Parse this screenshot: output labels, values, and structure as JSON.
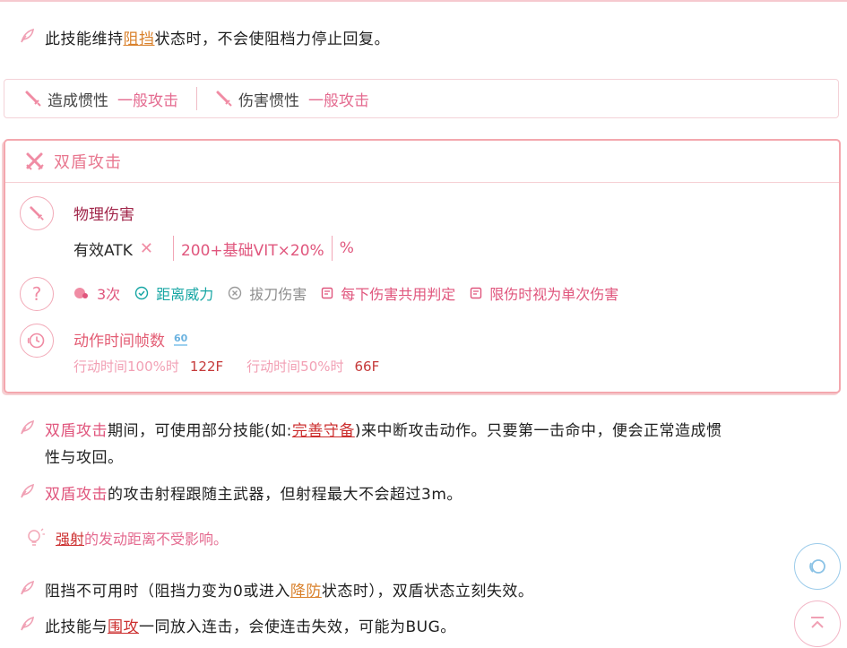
{
  "notes_top": {
    "pre": "此技能维持",
    "link": "阻挡",
    "post": "状态时，不会使阻档力停止回复。"
  },
  "inertia": {
    "cause_label": "造成惯性",
    "cause_value": "一般攻击",
    "damage_label": "伤害惯性",
    "damage_value": "一般攻击"
  },
  "skill": {
    "title": "双盾攻击",
    "damage_type": "物理伤害",
    "atk_label": "有效ATK",
    "atk_mark": "✕",
    "formula": "200+基础VIT×20%",
    "percent": "%",
    "hits": "3次",
    "flags": {
      "distance_power": "距离威力",
      "battou": "拔刀伤害",
      "shared_judge": "每下伤害共用判定",
      "limit_single": "限伤时视为单次伤害"
    },
    "frames_title": "动作时间帧数",
    "frames_badge": "60",
    "frames": [
      {
        "label": "行动时间100%时",
        "value": "122F"
      },
      {
        "label": "行动时间50%时",
        "value": "66F"
      }
    ]
  },
  "notes": {
    "n1_skill": "双盾攻击",
    "n1_a": "期间，可使用部分技能(如:",
    "n1_link": "完善守备",
    "n1_b": ")来中断攻击动作。只要第一击命中，便会正常造成惯",
    "n1_c": "性与攻回。",
    "n2_skill": "双盾攻击",
    "n2_text": "的攻击射程跟随主武器，但射程最大不会超过3m。",
    "tip_link": "强射",
    "tip_text": "的发动距离不受影响。",
    "n3_a": "阻挡不可用时（阻挡力变为0或进入",
    "n3_link": "降防",
    "n3_b": "状态时），双盾状态立刻失效。",
    "n4_a": "此技能与",
    "n4_link": "围攻",
    "n4_b": "一同放入连击，会使连击失效，可能为BUG。"
  },
  "colors": {
    "accent_pink": "#e0567d",
    "border_pink": "#f4a7ae",
    "teal": "#17a6a4",
    "link_orange": "#d9802a",
    "link_red": "#cc2f2f"
  },
  "icons": {
    "bullet": "leaf-icon",
    "sword": "sword-icon",
    "crossed": "crossed-swords-icon",
    "question": "question-icon",
    "timer": "timer-icon",
    "bulb": "bulb-icon"
  }
}
